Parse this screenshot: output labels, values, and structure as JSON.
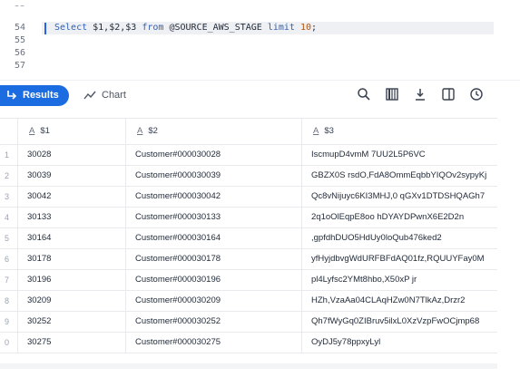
{
  "editor": {
    "lines": [
      {
        "number": "55"
      },
      {
        "number": "54",
        "code": "Select $1,$2,$3 from @SOURCE_AWS_STAGE limit 10;"
      },
      {
        "number": "55"
      },
      {
        "number": "56"
      },
      {
        "number": "57"
      }
    ],
    "code_parts": {
      "kw_select": "Select",
      "cols": " $1,$2,$3 ",
      "kw_from": "from",
      "stage": " @SOURCE_AWS_STAGE ",
      "kw_limit": "limit",
      "space": " ",
      "limit_value": "10",
      "end": ";"
    }
  },
  "toolbar": {
    "results_label": "Results",
    "chart_label": "Chart",
    "icons": [
      "search-icon",
      "columns-icon",
      "download-icon",
      "split-view-icon",
      "history-icon"
    ]
  },
  "grid": {
    "columns": [
      {
        "type_glyph": "A",
        "name": "$1"
      },
      {
        "type_glyph": "A",
        "name": "$2"
      },
      {
        "type_glyph": "A",
        "name": "$3"
      }
    ],
    "rows": [
      {
        "idx": "1",
        "c1": "30028",
        "c2": "Customer#000030028",
        "c3": "IscmupD4vmM 7UU2L5P6VC"
      },
      {
        "idx": "2",
        "c1": "30039",
        "c2": "Customer#000030039",
        "c3": "GBZX0S rsdO,FdA8OmmEqbbYIQOv2sypyKj"
      },
      {
        "idx": "3",
        "c1": "30042",
        "c2": "Customer#000030042",
        "c3": "Qc8vNijuyc6KI3MHJ,0 qGXv1DTDSHQAGh7"
      },
      {
        "idx": "4",
        "c1": "30133",
        "c2": "Customer#000030133",
        "c3": "2q1oOlEqpE8oo hDYAYDPwnX6E2D2n"
      },
      {
        "idx": "5",
        "c1": "30164",
        "c2": "Customer#000030164",
        "c3": ",gpfdhDUO5HdUy0loQub476ked2"
      },
      {
        "idx": "6",
        "c1": "30178",
        "c2": "Customer#000030178",
        "c3": "yfHyjdbvgWdURFBFdAQ01fz,RQUUYFay0M"
      },
      {
        "idx": "7",
        "c1": "30196",
        "c2": "Customer#000030196",
        "c3": "pl4Lyfsc2YMt8hbo,X50xP jr"
      },
      {
        "idx": "8",
        "c1": "30209",
        "c2": "Customer#000030209",
        "c3": "HZh,VzaAa04CLAqHZw0N7TlkAz,Drzr2"
      },
      {
        "idx": "9",
        "c1": "30252",
        "c2": "Customer#000030252",
        "c3": "Qh7fWyGq0ZIBruv5ilxL0XzVzpFwOCjmp68"
      },
      {
        "idx": "0",
        "c1": "30275",
        "c2": "Customer#000030275",
        "c3": "OyDJ5y78ppxyLyl"
      }
    ]
  },
  "colors": {
    "accent": "#1a6ce0",
    "keyword": "#2f5fb3",
    "number": "#b45309"
  }
}
